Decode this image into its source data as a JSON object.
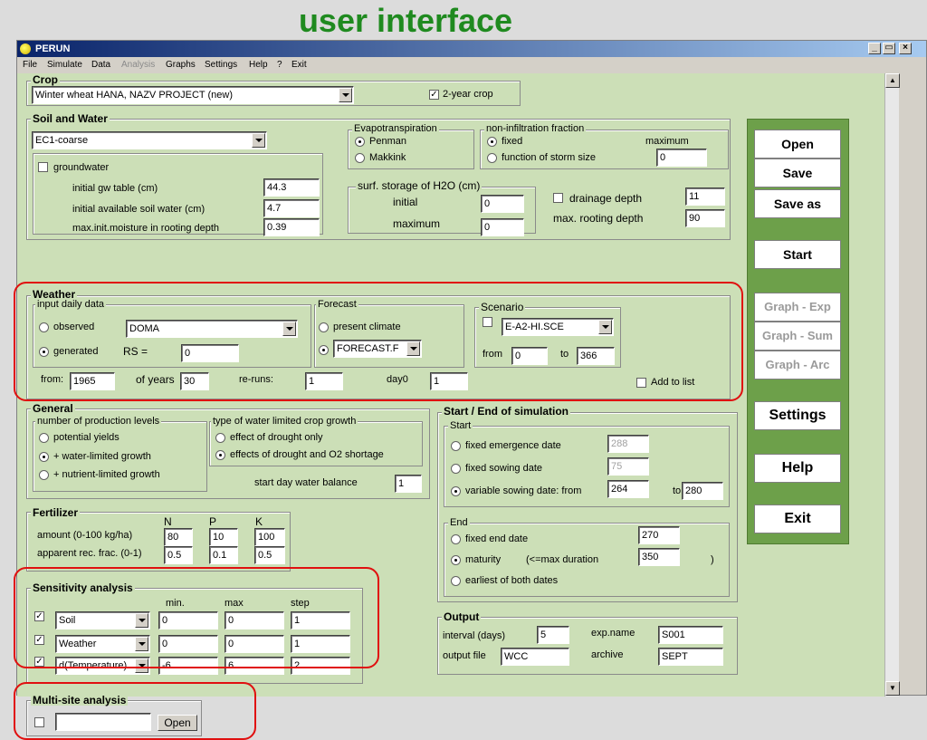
{
  "slide_title": "user interface",
  "window": {
    "title": "PERUN"
  },
  "menu": [
    "File",
    "Simulate",
    "Data",
    "Analysis",
    "Graphs",
    "Settings",
    "Help",
    "?",
    "Exit"
  ],
  "crop": {
    "label": "Crop",
    "selected": "Winter wheat HANA, NAZV PROJECT (new)",
    "two_year_label": "2-year crop"
  },
  "soil": {
    "label": "Soil and Water",
    "selected": "EC1-coarse",
    "groundwater_label": "groundwater",
    "gw_table_label": "initial gw table (cm)",
    "gw_table": "44.3",
    "avail_water_label": "initial available soil water (cm)",
    "avail_water": "4.7",
    "moisture_label": "max.init.moisture in rooting depth",
    "moisture": "0.39",
    "evap_label": "Evapotranspiration",
    "penman": "Penman",
    "makkink": "Makkink",
    "noninf_label": "non-infiltration fraction",
    "fixed": "fixed",
    "maximum": "maximum",
    "storm": "function of storm size",
    "noninf_value": "0",
    "surf_label": "surf. storage of H2O (cm)",
    "initial_label": "initial",
    "initial": "0",
    "maximum_label": "maximum",
    "max_value": "0",
    "drainage_label": "drainage  depth",
    "drainage": "11",
    "rooting_label": "max. rooting depth",
    "rooting": "90"
  },
  "weather": {
    "label": "Weather",
    "input_label": "input daily data",
    "observed": "observed",
    "station": "DOMA",
    "generated": "generated",
    "rs_label": "RS =",
    "rs": "0",
    "forecast_label": "Forecast",
    "present": "present climate",
    "forecast_file": "FORECAST.F",
    "scenario_label": "Scenario",
    "scenario_file": "E-A2-HI.SCE",
    "from_label": "from",
    "scen_from": "0",
    "to_label": "to",
    "scen_to": "366",
    "from2_label": "from:",
    "from_year": "1965",
    "years_label": "of years",
    "years": "30",
    "reruns_label": "re-runs:",
    "reruns": "1",
    "day0_label": "day0",
    "day0": "1",
    "add_list": "Add to list"
  },
  "general": {
    "label": "General",
    "levels_label": "number of production levels",
    "potential": "potential yields",
    "water": "+ water-limited growth",
    "nutrient": "+ nutrient-limited growth",
    "type_label": "type of water limited crop growth",
    "drought": "effect of drought only",
    "drought_o2": "effects of drought and O2 shortage",
    "start_day_label": "start day water balance",
    "start_day": "1"
  },
  "fertilizer": {
    "label": "Fertilizer",
    "n": "N",
    "p": "P",
    "k": "K",
    "amount_label": "amount (0-100 kg/ha)",
    "amount": [
      "80",
      "10",
      "100"
    ],
    "rec_label": "apparent rec. frac. (0-1)",
    "rec": [
      "0.5",
      "0.1",
      "0.5"
    ]
  },
  "sensitivity": {
    "label": "Sensitivity analysis",
    "min": "min.",
    "max": "max",
    "step": "step",
    "rows": [
      {
        "param": "Soil",
        "min": "0",
        "max": "0",
        "step": "1"
      },
      {
        "param": "Weather",
        "min": "0",
        "max": "0",
        "step": "1"
      },
      {
        "param": "d(Temperature)",
        "min": "-6",
        "max": "6",
        "step": "2"
      }
    ]
  },
  "multisite": {
    "label": "Multi-site analysis",
    "open": "Open"
  },
  "startend": {
    "label": "Start / End of simulation",
    "start_label": "Start",
    "emergence": "fixed emergence date",
    "emergence_val": "288",
    "sowing": "fixed sowing date",
    "sowing_val": "75",
    "variable": "variable sowing date:  from",
    "var_from": "264",
    "to_label": "to",
    "var_to": "280",
    "end_label": "End",
    "fixed_end": "fixed end date",
    "end_val": "270",
    "maturity": "maturity",
    "max_dur": "(<=max duration",
    "dur_val": "350",
    "close_paren": ")",
    "earliest": "earliest of both dates"
  },
  "output": {
    "label": "Output",
    "interval_label": "interval (days)",
    "interval": "5",
    "expname_label": "exp.name",
    "expname": "S001",
    "file_label": "output file",
    "file": "WCC",
    "archive_label": "archive",
    "archive": "SEPT"
  },
  "buttons": {
    "open": "Open",
    "save": "Save",
    "save_as": "Save as",
    "start": "Start",
    "graph_exp": "Graph - Exp",
    "graph_sum": "Graph - Sum",
    "graph_arc": "Graph - Arc",
    "settings": "Settings",
    "help": "Help",
    "exit": "Exit"
  }
}
